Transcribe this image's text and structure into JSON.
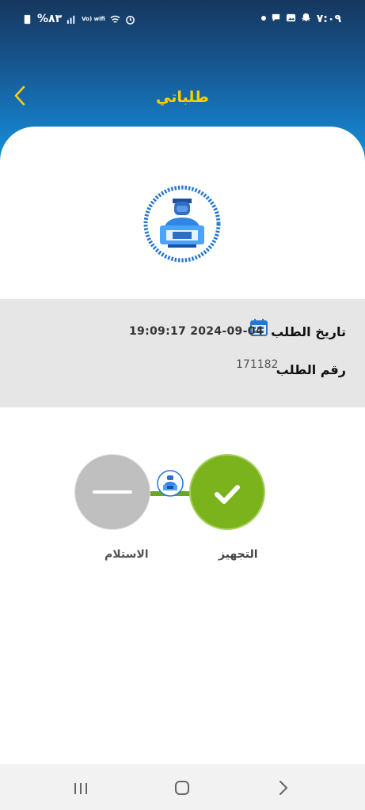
{
  "status_bar": {
    "time": "٧:٠٩",
    "battery": "%٨٣",
    "network": "Vo) wifi"
  },
  "header": {
    "title": "طلباتي"
  },
  "order": {
    "date_label": "تاريخ الطلب",
    "date_value": "19:09:17 2024-09-04",
    "number_label": "رقم الطلب",
    "number_value": "171182"
  },
  "tracking": {
    "steps": [
      {
        "label": "التجهيز",
        "status": "done"
      },
      {
        "label": "الاستلام",
        "status": "pending"
      }
    ]
  },
  "colors": {
    "accent_yellow": "#f7d100",
    "step_done": "#7ab31c",
    "step_pending": "#bfbfbf",
    "info_panel": "#e6e6e6"
  },
  "icons": {
    "back": "chevron-left-icon",
    "courier": "delivery-person-icon",
    "calendar": "calendar-icon",
    "check": "check-icon"
  }
}
